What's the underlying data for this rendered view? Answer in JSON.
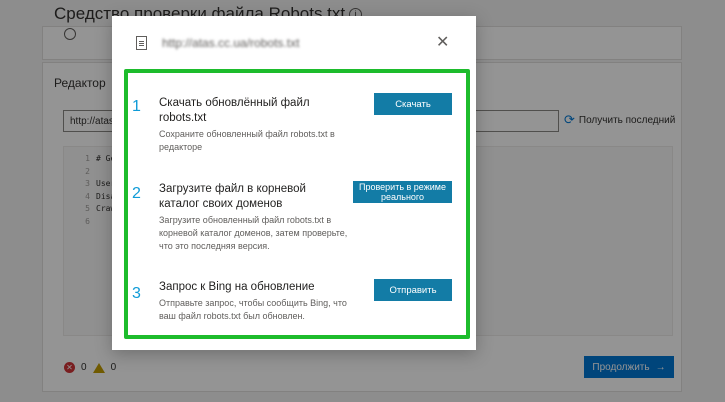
{
  "background": {
    "title": "Средство проверки файла Robots.txt",
    "editor_label": "Редактор",
    "url_value": "http://atas",
    "refresh_label": "Получить последний",
    "code_lines": [
      "# Ge",
      "",
      "User",
      "Disa",
      "Craw",
      ""
    ],
    "line_numbers": [
      "1",
      "2",
      "3",
      "4",
      "5",
      "6"
    ],
    "error_count": "0",
    "warning_count": "0",
    "continue_label": "Продолжить"
  },
  "modal": {
    "url": "http://atas.cc.ua/robots.txt",
    "close_symbol": "✕",
    "steps": [
      {
        "number": "1",
        "title": "Скачать обновлённый файл robots.txt",
        "description": "Сохраните обновленный файл robots.txt в редакторе",
        "button": "Скачать"
      },
      {
        "number": "2",
        "title": "Загрузите файл в корневой каталог своих доменов",
        "description": "Загрузите обновленный файл robots.txt в корневой каталог доменов, затем проверьте, что это последняя версия.",
        "button": "Проверить в режиме реального"
      },
      {
        "number": "3",
        "title": "Запрос к Bing на обновление",
        "description": "Отправьте запрос, чтобы сообщить Bing, что ваш файл robots.txt был обновлен.",
        "button": "Отправить"
      }
    ]
  },
  "colors": {
    "highlight_border": "#1dbc2c",
    "step_button": "#137ca6",
    "step_number": "#0f9bd7",
    "primary": "#0078d4"
  }
}
